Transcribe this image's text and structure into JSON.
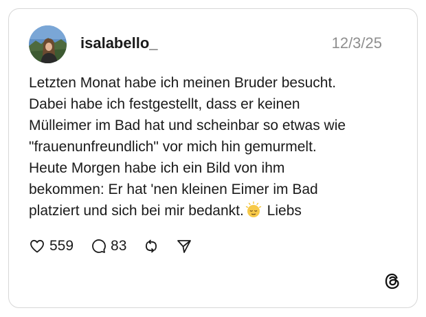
{
  "post": {
    "username": "isalabello_",
    "date": "12/3/25",
    "text_lines": [
      "Letzten Monat habe ich meinen Bruder besucht.",
      "Dabei habe ich festgestellt, dass er keinen",
      "Mülleimer im Bad hat und scheinbar so etwas wie",
      "\"frauenunfreundlich\" vor mich hin gemurmelt.",
      "Heute Morgen habe ich ein Bild von ihm",
      "bekommen: Er hat 'nen kleinen Eimer im Bad"
    ],
    "last_line_before_emoji": "platziert und sich bei mir bedankt.",
    "last_line_after_emoji": "Liebs",
    "emoji": "relieved-face-emoji"
  },
  "actions": {
    "likes": "559",
    "comments": "83",
    "repost_icon": "repost-icon",
    "share_icon": "share-icon"
  },
  "branding": {
    "logo": "threads-logo"
  }
}
